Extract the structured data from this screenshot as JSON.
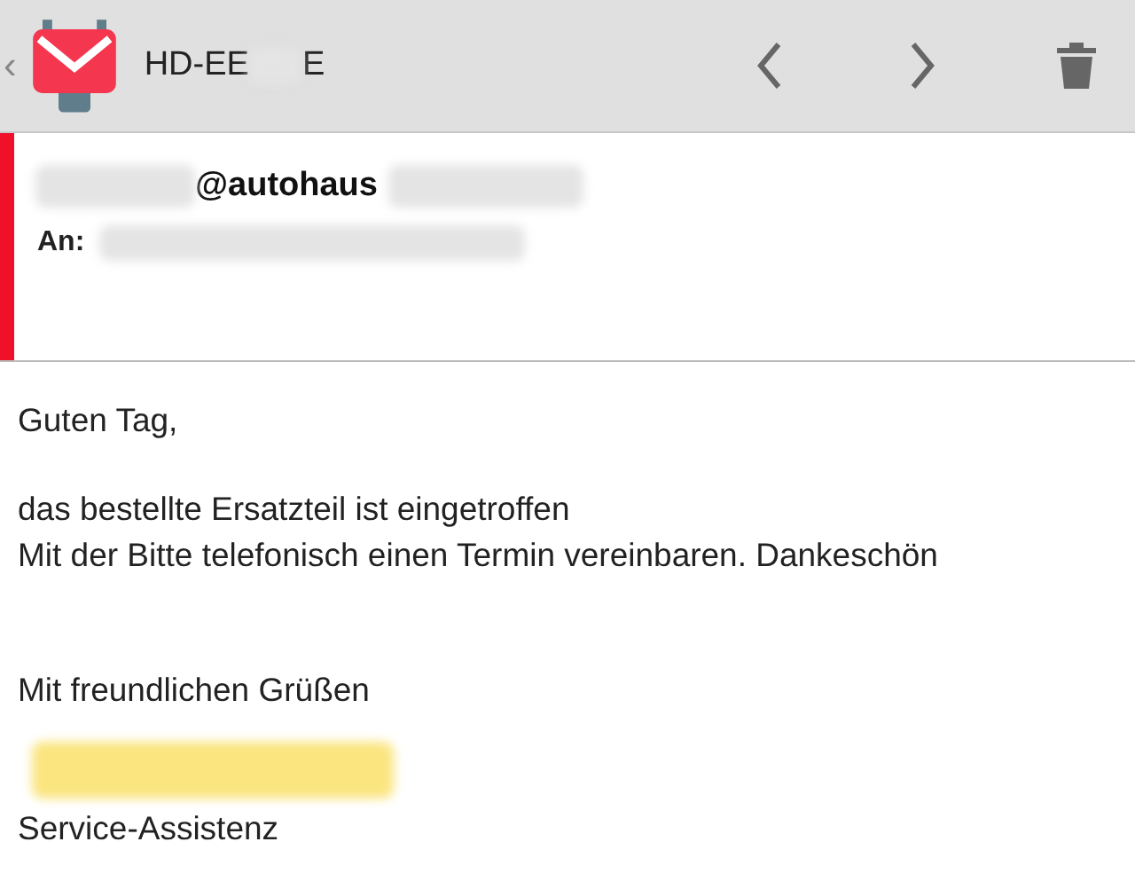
{
  "header": {
    "back_glyph": "‹",
    "title_start": "HD-EE",
    "title_end": "E"
  },
  "sender": {
    "address_visible": "@autohaus"
  },
  "recipient": {
    "label": "An:"
  },
  "body": {
    "greeting": "Guten Tag,",
    "lines": [
      "das bestellte Ersatzteil ist eingetroffen",
      "Mit der Bitte telefonisch einen Termin vereinbaren. Dankeschön"
    ],
    "closing": "Mit freundlichen Grüßen",
    "signature_role": "Service-Assistenz"
  }
}
